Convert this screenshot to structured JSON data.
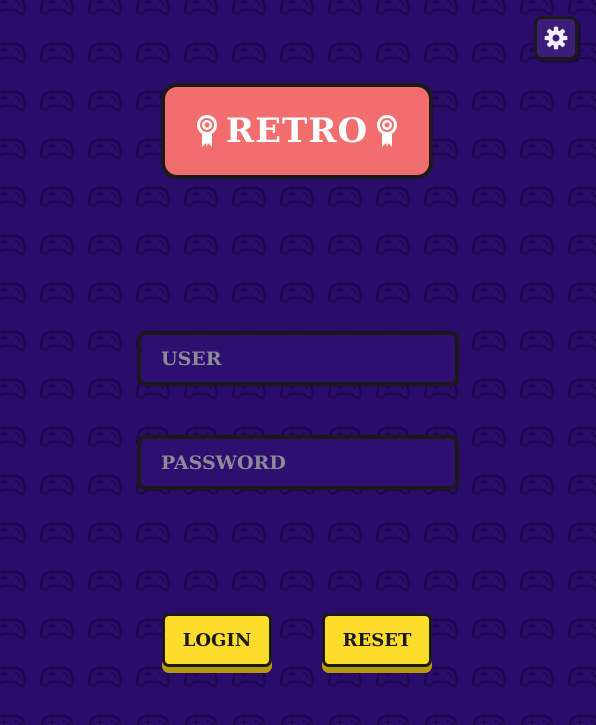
{
  "app": {
    "title": "RETRO",
    "logo_icon": "ribbon-badge-icon",
    "background_pattern_icon": "gamepad-icon"
  },
  "settings": {
    "icon": "gear-icon"
  },
  "form": {
    "username_placeholder": "USER",
    "password_placeholder": "PASSWORD"
  },
  "actions": {
    "login_label": "LOGIN",
    "reset_label": "RESET"
  },
  "colors": {
    "background": "#2a0d6b",
    "pattern": "#1f0750",
    "logo_bg": "#f26d6d",
    "button_bg": "#fddc2b",
    "border": "#1a1a1a",
    "placeholder": "#8c8a96"
  }
}
